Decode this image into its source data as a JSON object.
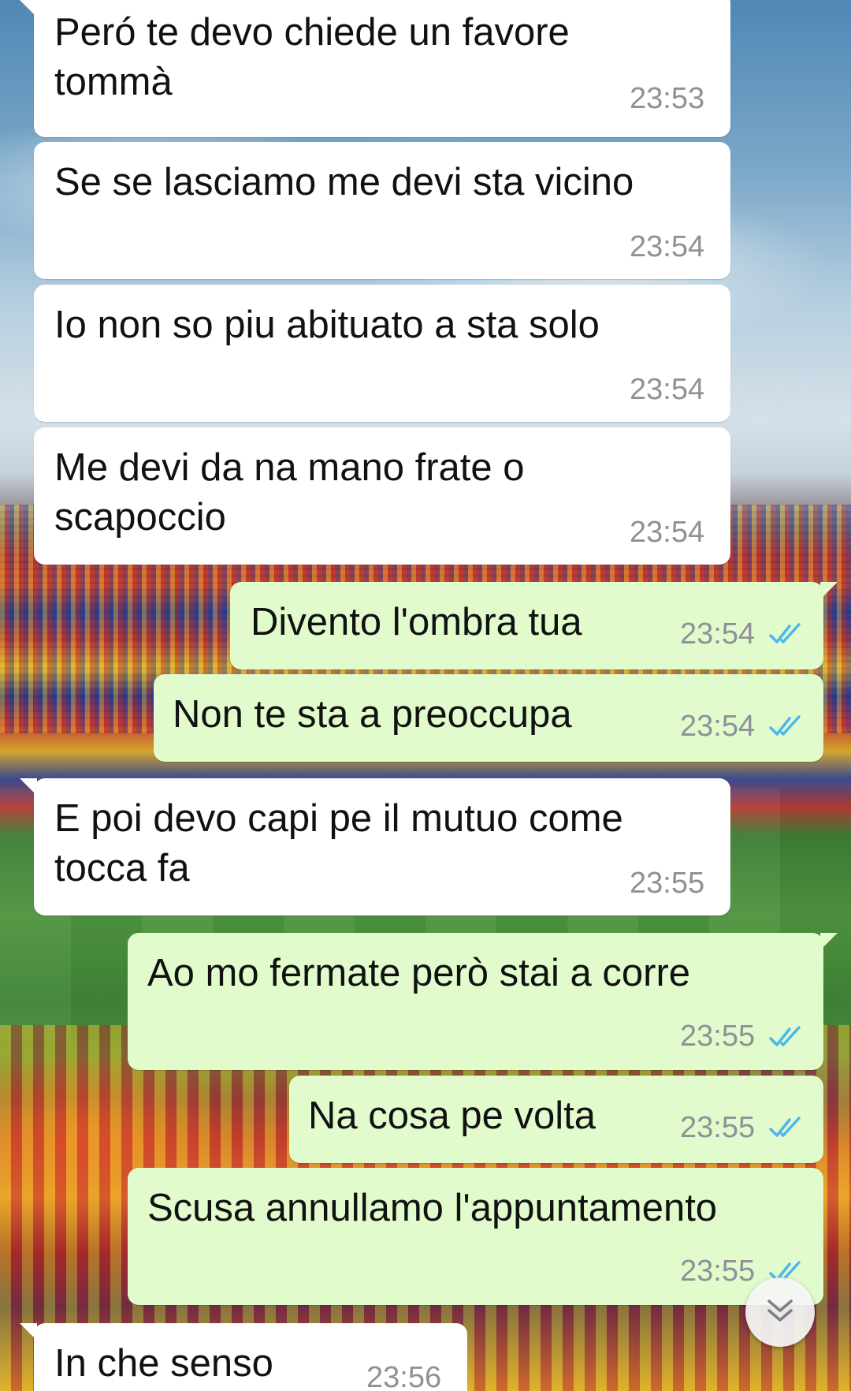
{
  "chat": {
    "messages": [
      {
        "direction": "in",
        "text": "Peró te devo chiede un favore\ntommà",
        "time": "23:53"
      },
      {
        "direction": "in",
        "text": "Se se lasciamo me devi sta vicino",
        "time": "23:54"
      },
      {
        "direction": "in",
        "text": "Io non so piu abituato a sta solo",
        "time": "23:54"
      },
      {
        "direction": "in",
        "text": "Me devi da na mano frate o\nscapoccio",
        "time": "23:54"
      },
      {
        "direction": "out",
        "text": "Divento l'ombra tua",
        "time": "23:54",
        "status": "read"
      },
      {
        "direction": "out",
        "text": "Non te sta a preoccupa",
        "time": "23:54",
        "status": "read"
      },
      {
        "direction": "in",
        "text": "E poi devo capi pe il mutuo come\ntocca fa",
        "time": "23:55"
      },
      {
        "direction": "out",
        "text": "Ao mo fermate però stai a corre",
        "time": "23:55",
        "status": "read"
      },
      {
        "direction": "out",
        "text": "Na cosa pe volta",
        "time": "23:55",
        "status": "read"
      },
      {
        "direction": "out",
        "text": "Scusa annullamo l'appuntamento",
        "time": "23:55",
        "status": "read"
      },
      {
        "direction": "in",
        "text": "In che senso",
        "time": "23:56"
      }
    ]
  },
  "icons": {
    "read_receipt": "double-check-icon",
    "scroll_down": "double-chevron-down-icon"
  },
  "colors": {
    "incoming_bubble": "#ffffff",
    "outgoing_bubble": "#e1fbcc",
    "read_tick": "#4fb6ec",
    "timestamp": "#8f9196"
  }
}
